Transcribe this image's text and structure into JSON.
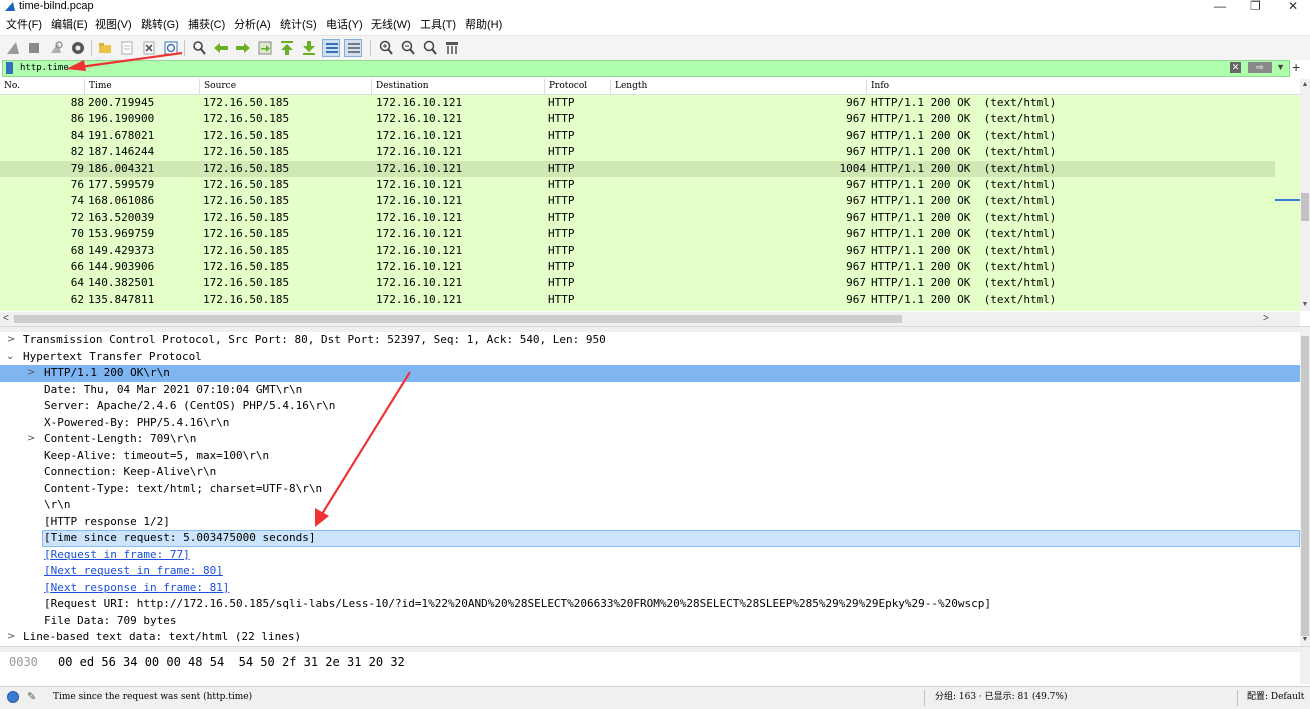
{
  "window": {
    "title": "time-bilnd.pcap",
    "controls": [
      "—",
      "❐",
      "✕"
    ]
  },
  "menu": [
    "文件(F)",
    "编辑(E)",
    "视图(V)",
    "跳转(G)",
    "捕获(C)",
    "分析(A)",
    "统计(S)",
    "电话(Y)",
    "无线(W)",
    "工具(T)",
    "帮助(H)"
  ],
  "filter": {
    "value": "http.time",
    "plus": "+"
  },
  "packet_list": {
    "columns": [
      "No.",
      "Time",
      "Source",
      "Destination",
      "Protocol",
      "Length",
      "Info"
    ],
    "rows": [
      {
        "no": "88",
        "time": "200.719945",
        "src": "172.16.50.185",
        "dst": "172.16.10.121",
        "proto": "HTTP",
        "len": "967",
        "info": "HTTP/1.1 200 OK  (text/html)"
      },
      {
        "no": "86",
        "time": "196.190900",
        "src": "172.16.50.185",
        "dst": "172.16.10.121",
        "proto": "HTTP",
        "len": "967",
        "info": "HTTP/1.1 200 OK  (text/html)"
      },
      {
        "no": "84",
        "time": "191.678021",
        "src": "172.16.50.185",
        "dst": "172.16.10.121",
        "proto": "HTTP",
        "len": "967",
        "info": "HTTP/1.1 200 OK  (text/html)"
      },
      {
        "no": "82",
        "time": "187.146244",
        "src": "172.16.50.185",
        "dst": "172.16.10.121",
        "proto": "HTTP",
        "len": "967",
        "info": "HTTP/1.1 200 OK  (text/html)"
      },
      {
        "no": "79",
        "time": "186.004321",
        "src": "172.16.50.185",
        "dst": "172.16.10.121",
        "proto": "HTTP",
        "len": "1004",
        "info": "HTTP/1.1 200 OK  (text/html)",
        "selected": true
      },
      {
        "no": "76",
        "time": "177.599579",
        "src": "172.16.50.185",
        "dst": "172.16.10.121",
        "proto": "HTTP",
        "len": "967",
        "info": "HTTP/1.1 200 OK  (text/html)"
      },
      {
        "no": "74",
        "time": "168.061086",
        "src": "172.16.50.185",
        "dst": "172.16.10.121",
        "proto": "HTTP",
        "len": "967",
        "info": "HTTP/1.1 200 OK  (text/html)"
      },
      {
        "no": "72",
        "time": "163.520039",
        "src": "172.16.50.185",
        "dst": "172.16.10.121",
        "proto": "HTTP",
        "len": "967",
        "info": "HTTP/1.1 200 OK  (text/html)"
      },
      {
        "no": "70",
        "time": "153.969759",
        "src": "172.16.50.185",
        "dst": "172.16.10.121",
        "proto": "HTTP",
        "len": "967",
        "info": "HTTP/1.1 200 OK  (text/html)"
      },
      {
        "no": "68",
        "time": "149.429373",
        "src": "172.16.50.185",
        "dst": "172.16.10.121",
        "proto": "HTTP",
        "len": "967",
        "info": "HTTP/1.1 200 OK  (text/html)"
      },
      {
        "no": "66",
        "time": "144.903906",
        "src": "172.16.50.185",
        "dst": "172.16.10.121",
        "proto": "HTTP",
        "len": "967",
        "info": "HTTP/1.1 200 OK  (text/html)"
      },
      {
        "no": "64",
        "time": "140.382501",
        "src": "172.16.50.185",
        "dst": "172.16.10.121",
        "proto": "HTTP",
        "len": "967",
        "info": "HTTP/1.1 200 OK  (text/html)"
      },
      {
        "no": "62",
        "time": "135.847811",
        "src": "172.16.50.185",
        "dst": "172.16.10.121",
        "proto": "HTTP",
        "len": "967",
        "info": "HTTP/1.1 200 OK  (text/html)"
      }
    ]
  },
  "details": {
    "tcp": "Transmission Control Protocol, Src Port: 80, Dst Port: 52397, Seq: 1, Ack: 540, Len: 950",
    "http": "Hypertext Transfer Protocol",
    "status_line": "HTTP/1.1 200 OK\\r\\n",
    "date": "Date: Thu, 04 Mar 2021 07:10:04 GMT\\r\\n",
    "server": "Server: Apache/2.4.6 (CentOS) PHP/5.4.16\\r\\n",
    "powered": "X-Powered-By: PHP/5.4.16\\r\\n",
    "content_length": "Content-Length: 709\\r\\n",
    "keepalive": "Keep-Alive: timeout=5, max=100\\r\\n",
    "connection": "Connection: Keep-Alive\\r\\n",
    "content_type": "Content-Type: text/html; charset=UTF-8\\r\\n",
    "crlf": "\\r\\n",
    "response_num": "[HTTP response 1/2]",
    "time_since_request": "[Time since request: 5.003475000 seconds]",
    "request_in_frame": "[Request in frame: 77]",
    "next_request": "[Next request in frame: 80]",
    "next_response": "[Next response in frame: 81]",
    "request_uri": "[Request URI: http://172.16.50.185/sqli-labs/Less-10/?id=1%22%20AND%20%28SELECT%206633%20FROM%20%28SELECT%28SLEEP%285%29%29%29Epky%29--%20wscp]",
    "file_data": "File Data: 709 bytes",
    "line_based": "Line-based text data: text/html (22 lines)"
  },
  "bytes": {
    "offset": "0030",
    "hex": "00 ed 56 34 00 00 48 54  54 50 2f 31 2e 31 20 32"
  },
  "status": {
    "field_desc": "Time since the request was sent (http.time)",
    "packets": "分组: 163 · 已显示: 81 (49.7%)",
    "profile": "配置: Default"
  },
  "colors": {
    "row_bg": "#e4ffc7",
    "selected_row": "#cfe8b4",
    "tree_selected": "#7fb6f2",
    "field_selected": "#cbe4fb",
    "filter_ok": "#afffaf",
    "annotation_arrow": "#ee3333"
  },
  "icons": [
    "shark-fin-icon",
    "stop-icon",
    "restart-icon",
    "options-gear-icon",
    "open-folder-icon",
    "save-icon",
    "close-file-icon",
    "reload-icon",
    "find-icon",
    "go-back-icon",
    "go-forward-icon",
    "go-to-packet-icon",
    "go-first-icon",
    "go-last-icon",
    "autoscroll-icon",
    "colorize-icon",
    "zoom-in-icon",
    "zoom-out-icon",
    "zoom-normal-icon",
    "resize-columns-icon"
  ]
}
